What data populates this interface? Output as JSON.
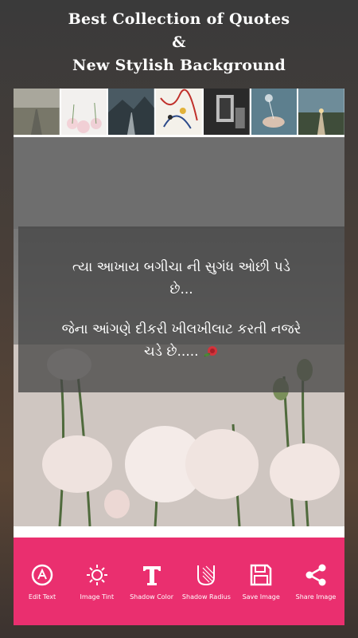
{
  "header": {
    "line1": "Best Collection of Quotes",
    "line2": "&",
    "line3": "New Stylish Background"
  },
  "thumbnails": [
    {
      "icon": "road-background-thumbnail"
    },
    {
      "icon": "flowers-background-thumbnail"
    },
    {
      "icon": "mountain-road-background-thumbnail"
    },
    {
      "icon": "abstract-art-background-thumbnail"
    },
    {
      "icon": "dark-objects-background-thumbnail"
    },
    {
      "icon": "hand-dandelion-background-thumbnail"
    },
    {
      "icon": "sunset-road-background-thumbnail"
    }
  ],
  "quote": {
    "line1": "ત્યા આખાય બગીચા ની સુગંધ ઓછી પડે",
    "line2": "છે...",
    "line3": "જેના આંગણે દીકરી ખીલખીલાટ કરતી નજરે",
    "line4": "ચડે છે....."
  },
  "toolbar": {
    "items": [
      {
        "label": "Edit Text",
        "icon": "edit-text-icon"
      },
      {
        "label": "Image Tint",
        "icon": "sun-icon"
      },
      {
        "label": "Shadow Color",
        "icon": "text-t-icon"
      },
      {
        "label": "Shadow Radius",
        "icon": "shadow-radius-icon"
      },
      {
        "label": "Save Image",
        "icon": "save-icon"
      },
      {
        "label": "Share Image",
        "icon": "share-icon"
      }
    ],
    "color": "#ea2f6f"
  }
}
